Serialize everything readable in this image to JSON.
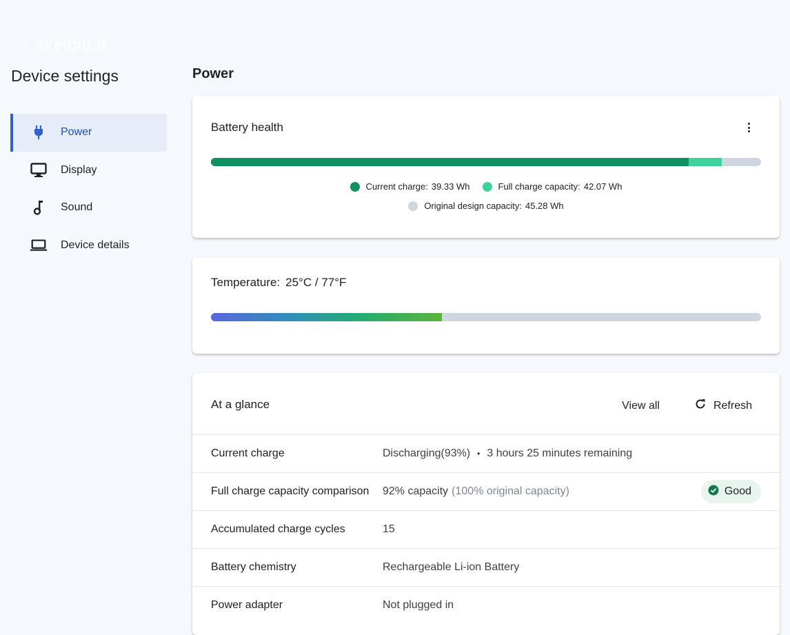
{
  "watermark": {
    "text": "skelbiu.lt"
  },
  "sidebar": {
    "title": "Device settings",
    "items": [
      {
        "label": "Power",
        "icon": "plug-icon",
        "active": true
      },
      {
        "label": "Display",
        "icon": "monitor-icon",
        "active": false
      },
      {
        "label": "Sound",
        "icon": "music-note-icon",
        "active": false
      },
      {
        "label": "Device details",
        "icon": "laptop-icon",
        "active": false
      }
    ]
  },
  "main": {
    "title": "Power",
    "battery_health": {
      "title": "Battery health",
      "current_charge_wh": 39.33,
      "full_charge_wh": 42.07,
      "design_capacity_wh": 45.28,
      "legend": {
        "current_label": "Current charge:",
        "current_value": "39.33 Wh",
        "full_label": "Full charge capacity:",
        "full_value": "42.07 Wh",
        "design_label": "Original design capacity:",
        "design_value": "45.28 Wh"
      },
      "colors": {
        "current": "#108f5f",
        "full": "#3dd39a",
        "design": "#cdd6e1"
      }
    },
    "temperature": {
      "label": "Temperature:",
      "value": "25°C / 77°F",
      "level": 0.42
    },
    "glance": {
      "title": "At a glance",
      "view_all": "View all",
      "refresh": "Refresh",
      "rows": [
        {
          "label": "Current charge",
          "value": "Discharging(93%)",
          "sep": "•",
          "extra": "3 hours 25 minutes remaining"
        },
        {
          "label": "Full charge capacity comparison",
          "value": "92% capacity",
          "muted": "(100% original capacity)",
          "badge": "Good"
        },
        {
          "label": "Accumulated charge cycles",
          "value": "15"
        },
        {
          "label": "Battery chemistry",
          "value": "Rechargeable Li-ion Battery"
        },
        {
          "label": "Power adapter",
          "value": "Not plugged in"
        }
      ]
    }
  }
}
